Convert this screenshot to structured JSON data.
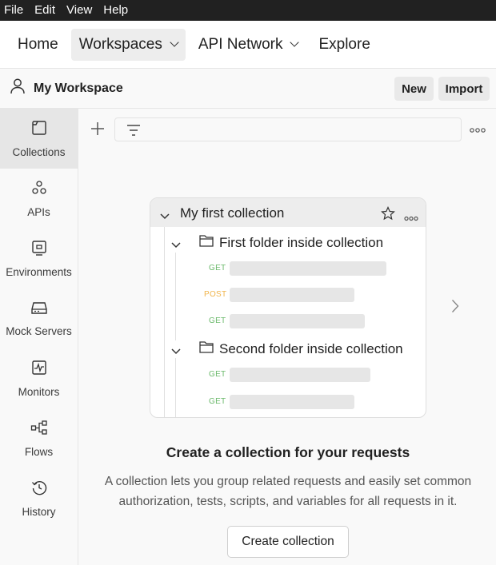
{
  "menubar": {
    "items": [
      "File",
      "Edit",
      "View",
      "Help"
    ]
  },
  "topnav": {
    "home": "Home",
    "workspaces": "Workspaces",
    "api_network": "API Network",
    "explore": "Explore"
  },
  "workspace": {
    "title": "My Workspace",
    "new_label": "New",
    "import_label": "Import"
  },
  "sidebar": {
    "items": [
      {
        "label": "Collections",
        "icon": "collections-icon",
        "active": true
      },
      {
        "label": "APIs",
        "icon": "apis-icon"
      },
      {
        "label": "Environments",
        "icon": "environments-icon"
      },
      {
        "label": "Mock Servers",
        "icon": "mock-servers-icon"
      },
      {
        "label": "Monitors",
        "icon": "monitors-icon"
      },
      {
        "label": "Flows",
        "icon": "flows-icon"
      },
      {
        "label": "History",
        "icon": "history-icon"
      }
    ]
  },
  "illustration": {
    "collection_title": "My first collection",
    "folders": [
      {
        "title": "First folder inside collection",
        "requests": [
          "GET",
          "POST",
          "GET"
        ]
      },
      {
        "title": "Second folder inside collection",
        "requests": [
          "GET",
          "GET"
        ]
      }
    ]
  },
  "empty_state": {
    "title": "Create a collection for your requests",
    "line1": "A collection lets you group related requests and easily set common",
    "line2": "authorization, tests, scripts, and variables for all requests in it.",
    "button": "Create collection"
  },
  "colors": {
    "get": "#6bb96b",
    "post": "#f0b44b",
    "menubar_bg": "#212121"
  }
}
